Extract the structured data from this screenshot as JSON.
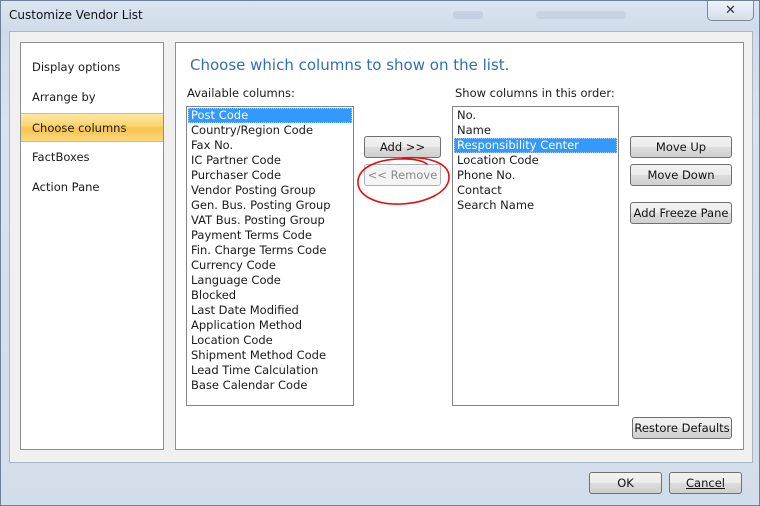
{
  "window": {
    "title": "Customize Vendor List",
    "close_icon": "close-icon"
  },
  "nav": {
    "items": [
      {
        "label": "Display options",
        "active": false
      },
      {
        "label": "Arrange by",
        "active": false
      },
      {
        "label": "Choose columns",
        "active": true
      },
      {
        "label": "FactBoxes",
        "active": false
      },
      {
        "label": "Action Pane",
        "active": false
      }
    ]
  },
  "main": {
    "heading": "Choose which columns to show on the list.",
    "available_label": "Available columns:",
    "available_columns": [
      "Post Code",
      "Country/Region Code",
      "Fax No.",
      "IC Partner Code",
      "Purchaser Code",
      "Vendor Posting Group",
      "Gen. Bus. Posting Group",
      "VAT Bus. Posting Group",
      "Payment Terms Code",
      "Fin. Charge Terms Code",
      "Currency Code",
      "Language Code",
      "Blocked",
      "Last Date Modified",
      "Application Method",
      "Location Code",
      "Shipment Method Code",
      "Lead Time Calculation",
      "Base Calendar Code"
    ],
    "available_selected": "Post Code",
    "show_label": "Show columns in this order:",
    "show_columns": [
      "No.",
      "Name",
      "Responsibility Center",
      "Location Code",
      "Phone No.",
      "Contact",
      "Search Name"
    ],
    "show_selected": "Responsibility Center",
    "buttons": {
      "add": "Add >>",
      "remove": "<< Remove",
      "move_up": "Move Up",
      "move_down": "Move Down",
      "add_freeze_pane": "Add Freeze Pane",
      "restore_defaults": "Restore Defaults"
    }
  },
  "footer": {
    "ok": "OK",
    "cancel": "Cancel"
  },
  "colors": {
    "selection": "#3399ff",
    "heading": "#2f6fb8",
    "active_nav": "#f7c34f",
    "annotation": "#e01010"
  }
}
